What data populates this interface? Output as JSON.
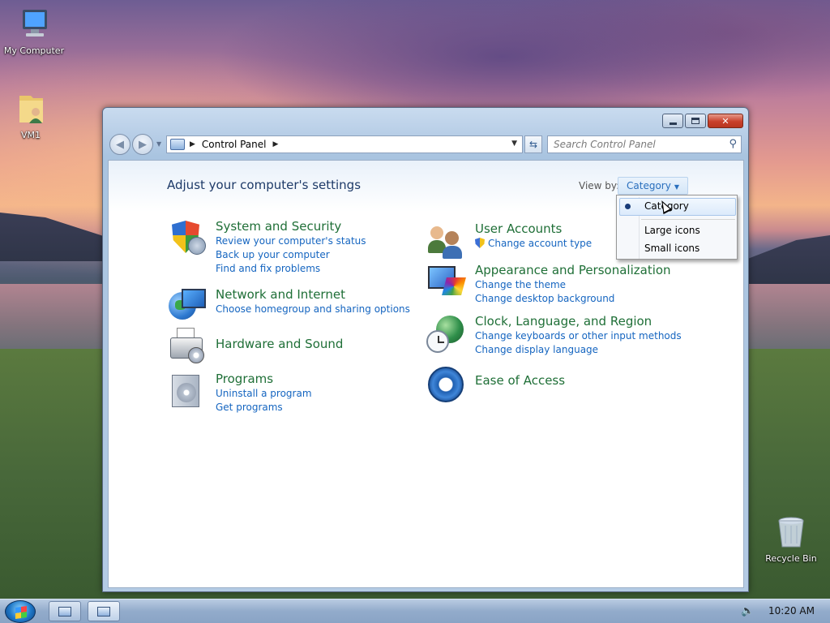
{
  "desktop": {
    "icons": [
      {
        "label": "My Computer",
        "icon": "computer-icon"
      },
      {
        "label": "VM1",
        "icon": "folder-user-icon"
      },
      {
        "label": "Recycle Bin",
        "icon": "recycle-bin-icon"
      }
    ]
  },
  "window": {
    "address": {
      "crumbs": [
        "Control Panel"
      ],
      "search_placeholder": "Search Control Panel"
    },
    "page_title": "Adjust your computer's settings",
    "view_by": {
      "label": "View by:",
      "value": "Category"
    },
    "categories": [
      {
        "title": "System and Security",
        "icon": "security-shield-icon",
        "links": [
          "Review your computer's status",
          "Back up your computer",
          "Find and fix problems"
        ]
      },
      {
        "title": "Network and Internet",
        "icon": "network-globe-icon",
        "links": [
          "Choose homegroup and sharing options"
        ]
      },
      {
        "title": "Hardware and Sound",
        "icon": "printer-icon",
        "links": []
      },
      {
        "title": "Programs",
        "icon": "programs-icon",
        "links": [
          "Uninstall a program",
          "Get programs"
        ]
      },
      {
        "title": "User Accounts",
        "icon": "users-icon",
        "links": [
          "Change account type"
        ]
      },
      {
        "title": "Appearance and Personalization",
        "icon": "appearance-icon",
        "links": [
          "Change the theme",
          "Change desktop background"
        ]
      },
      {
        "title": "Clock, Language, and Region",
        "icon": "clock-globe-icon",
        "links": [
          "Change keyboards or other input methods",
          "Change display language"
        ]
      },
      {
        "title": "Ease of Access",
        "icon": "ease-of-access-icon",
        "links": []
      }
    ]
  },
  "view_menu": {
    "items": [
      "Category",
      "Large icons",
      "Small icons"
    ],
    "selected": "Category"
  },
  "taskbar": {
    "clock": "10:20 AM"
  },
  "colors": {
    "category_title": "#1f6f37",
    "link": "#1565c0",
    "heading": "#1e3a68",
    "close_button": "#c9402b"
  }
}
